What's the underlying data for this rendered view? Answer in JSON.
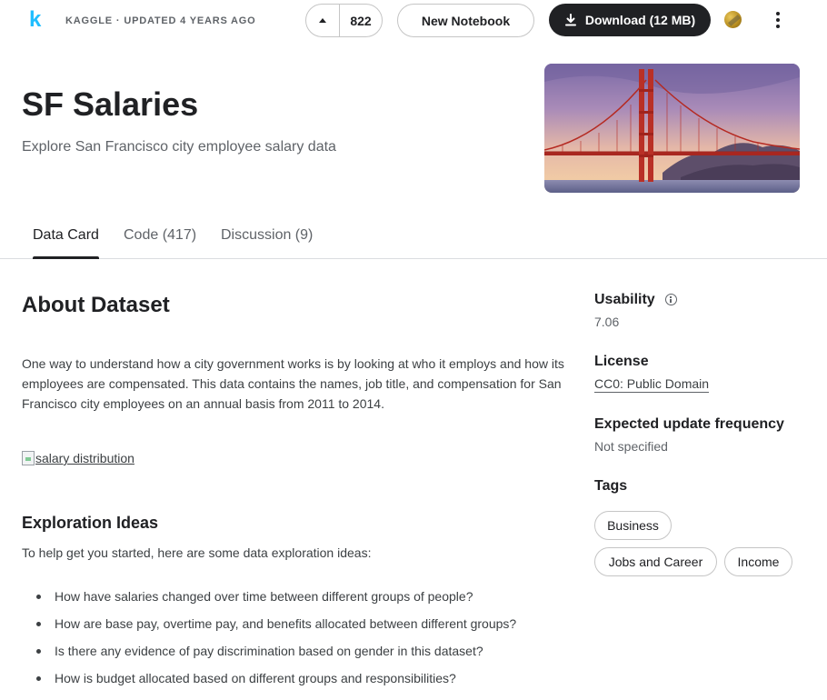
{
  "topbar": {
    "logo_letter": "k",
    "source": "KAGGLE",
    "separator": "·",
    "updated": "UPDATED 4 YEARS AGO",
    "upvotes": "822",
    "new_notebook_label": "New Notebook",
    "download_label": "Download (12 MB)"
  },
  "header": {
    "title": "SF Salaries",
    "subtitle": "Explore San Francisco city employee salary data"
  },
  "tabs": [
    {
      "label": "Data Card",
      "active": true
    },
    {
      "label": "Code (417)",
      "active": false
    },
    {
      "label": "Discussion (9)",
      "active": false
    }
  ],
  "about": {
    "title": "About Dataset",
    "body": "One way to understand how a city government works is by looking at who it employs and how its employees are compensated. This data contains the names, job title, and compensation for San Francisco city employees on an annual basis from 2011 to 2014.",
    "image_alt": "salary distribution"
  },
  "exploration": {
    "title": "Exploration Ideas",
    "intro": "To help get you started, here are some data exploration ideas:",
    "ideas": [
      "How have salaries changed over time between different groups of people?",
      "How are base pay, overtime pay, and benefits allocated between different groups?",
      "Is there any evidence of pay discrimination based on gender in this dataset?",
      "How is budget allocated based on different groups and responsibilities?"
    ]
  },
  "sidebar": {
    "usability_label": "Usability",
    "usability_value": "7.06",
    "license_label": "License",
    "license_value": "CC0: Public Domain",
    "frequency_label": "Expected update frequency",
    "frequency_value": "Not specified",
    "tags_label": "Tags",
    "tags": [
      "Business",
      "Jobs and Career",
      "Income"
    ]
  },
  "colors": {
    "primary_text": "#202124",
    "secondary_text": "#5f6368",
    "download_bg": "#202124",
    "kaggle_blue": "#20beff",
    "border": "#c5c5c5"
  },
  "icons": {
    "upvote": "triangle-up-icon",
    "download": "download-arrow-icon",
    "medal": "gold-medal-icon",
    "more": "vertical-dots-icon",
    "info": "info-circle-icon"
  }
}
